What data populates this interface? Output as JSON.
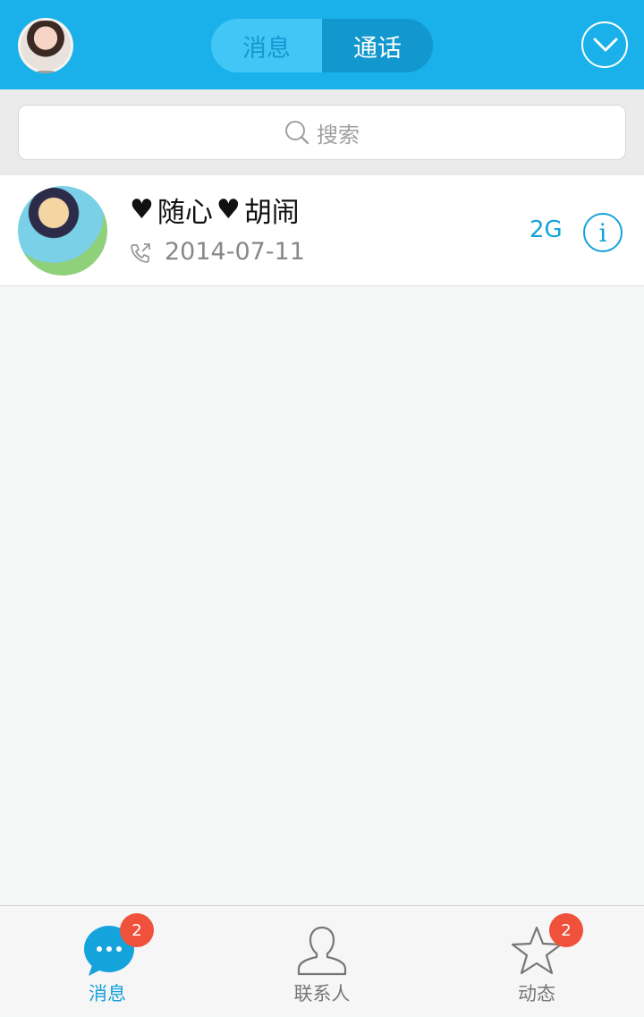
{
  "header": {
    "tabs": [
      {
        "label": "消息",
        "active": false
      },
      {
        "label": "通话",
        "active": true
      }
    ],
    "menu_icon": "chevron-down-circle-icon"
  },
  "search": {
    "placeholder": "搜索",
    "icon": "search-icon"
  },
  "calls": [
    {
      "name_part1": "随心",
      "name_part2": "胡闹",
      "date": "2014-07-11",
      "network": "2G",
      "call_icon": "outgoing-call-icon",
      "info_icon": "info-icon"
    }
  ],
  "tabbar": {
    "items": [
      {
        "label": "消息",
        "badge": "2",
        "icon": "chat-bubble-icon",
        "active": true
      },
      {
        "label": "联系人",
        "badge": "",
        "icon": "contact-person-icon",
        "active": false
      },
      {
        "label": "动态",
        "badge": "2",
        "icon": "star-icon",
        "active": false
      }
    ]
  },
  "colors": {
    "accent": "#1ab1ea",
    "badge": "#f0513a",
    "link": "#15a3dc"
  }
}
